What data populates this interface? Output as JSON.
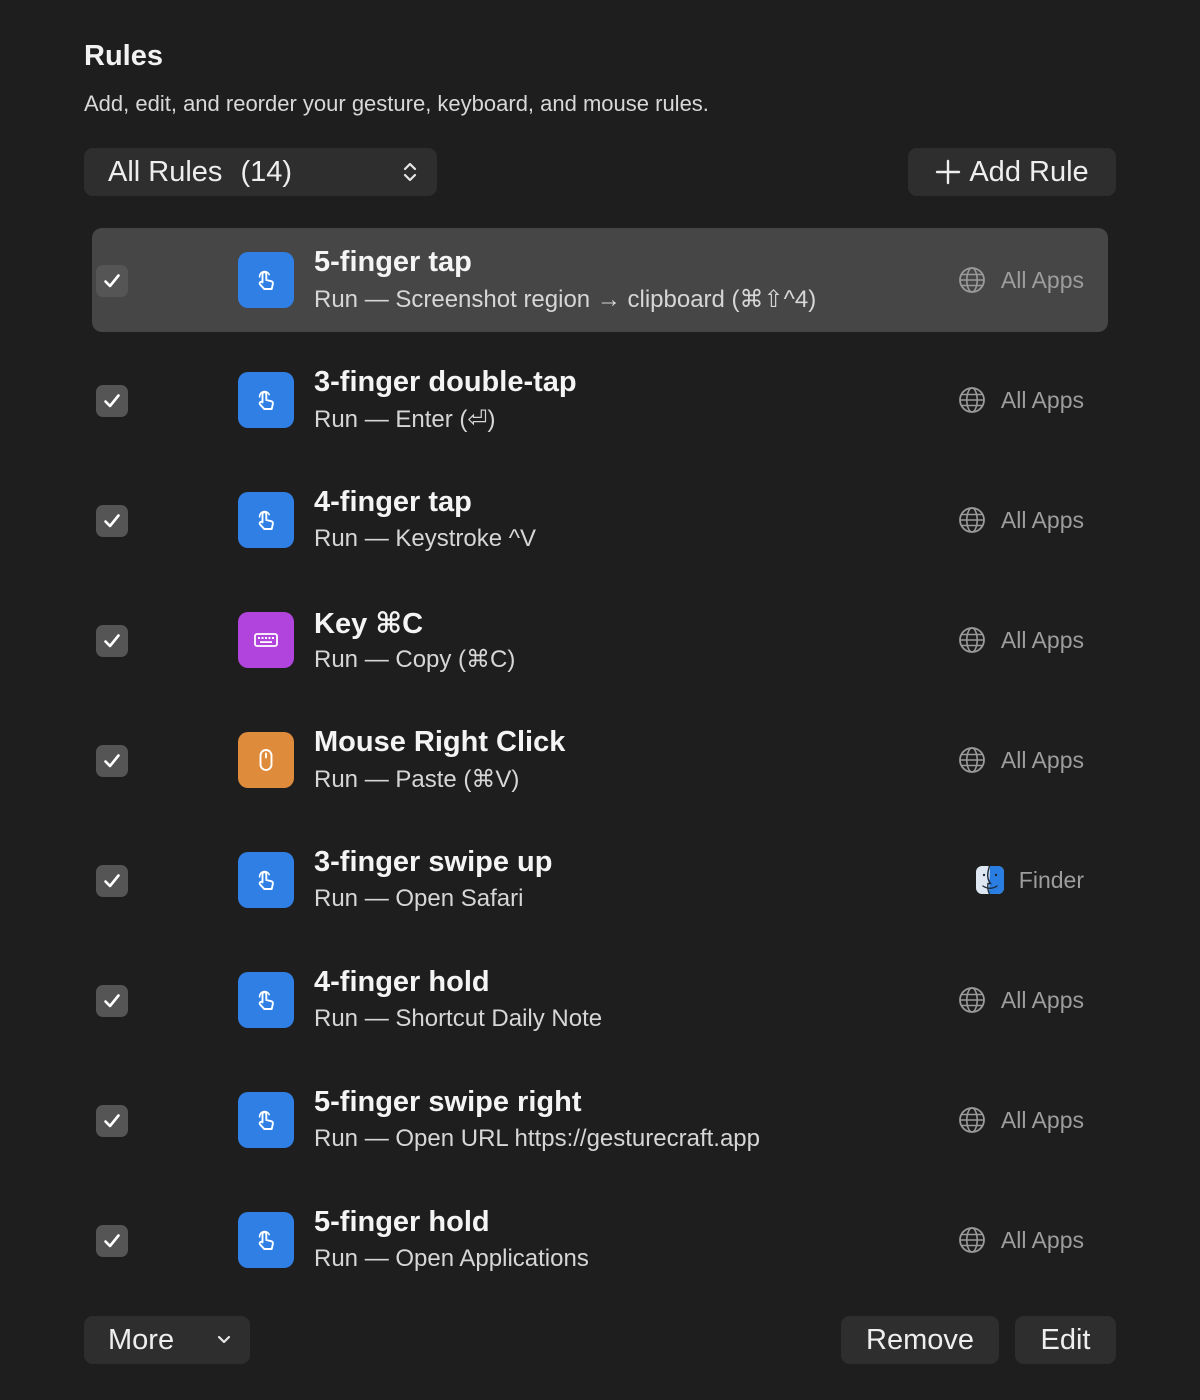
{
  "header": {
    "title": "Rules",
    "subtitle": "Add, edit, and reorder your gesture, keyboard, and mouse rules."
  },
  "toolbar": {
    "filter_label": "All Rules",
    "filter_count": "(14)",
    "add_label": "Add Rule"
  },
  "colors": {
    "gesture": "#2f7fe5",
    "keyboard": "#b044dc",
    "mouse": "#df8b3c"
  },
  "rules": [
    {
      "name": "5-finger tap",
      "action": "Run — Screenshot region → clipboard (⌘⇧^4)",
      "scope": "All Apps",
      "icon": "gesture",
      "enabled": true,
      "selected": true
    },
    {
      "name": "3-finger double-tap",
      "action": "Run — Enter (⏎)",
      "scope": "All Apps",
      "icon": "gesture",
      "enabled": true,
      "selected": false
    },
    {
      "name": "4-finger tap",
      "action": "Run — Keystroke ^V",
      "scope": "All Apps",
      "icon": "gesture",
      "enabled": true,
      "selected": false
    },
    {
      "name": "Key ⌘C",
      "action": "Run — Copy (⌘C)",
      "scope": "All Apps",
      "icon": "keyboard",
      "enabled": true,
      "selected": false
    },
    {
      "name": "Mouse Right Click",
      "action": "Run — Paste (⌘V)",
      "scope": "All Apps",
      "icon": "mouse",
      "enabled": true,
      "selected": false
    },
    {
      "name": "3-finger swipe up",
      "action": "Run — Open Safari",
      "scope": "Finder",
      "icon": "gesture",
      "enabled": true,
      "selected": false,
      "scope_icon": "finder"
    },
    {
      "name": "4-finger hold",
      "action": "Run — Shortcut Daily Note",
      "scope": "All Apps",
      "icon": "gesture",
      "enabled": true,
      "selected": false
    },
    {
      "name": "5-finger swipe right",
      "action": "Run — Open URL https://gesturecraft.app",
      "scope": "All Apps",
      "icon": "gesture",
      "enabled": true,
      "selected": false
    },
    {
      "name": "5-finger hold",
      "action": "Run — Open Applications",
      "scope": "All Apps",
      "icon": "gesture",
      "enabled": true,
      "selected": false
    }
  ],
  "footer": {
    "more_label": "More",
    "remove_label": "Remove",
    "edit_label": "Edit"
  }
}
